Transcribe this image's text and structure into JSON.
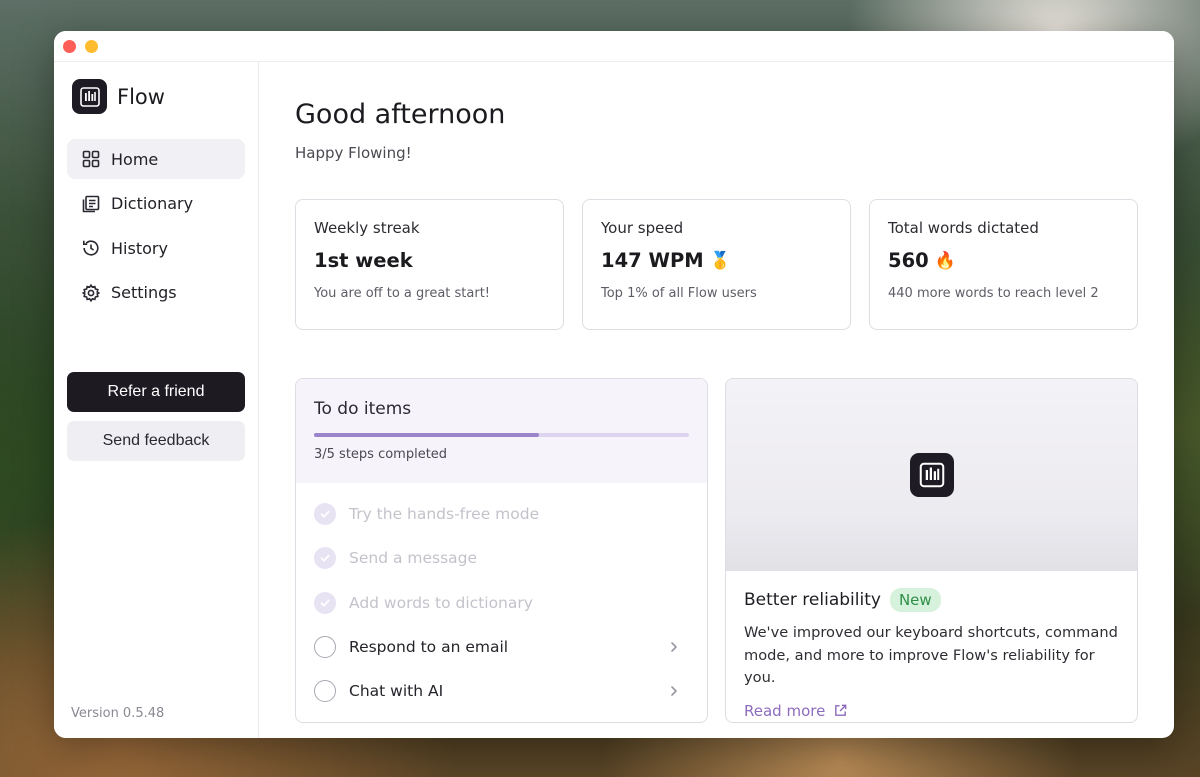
{
  "app": {
    "name": "Flow",
    "version": "Version 0.5.48"
  },
  "sidebar": {
    "items": [
      {
        "label": "Home",
        "icon": "grid-icon",
        "active": true
      },
      {
        "label": "Dictionary",
        "icon": "book-icon",
        "active": false
      },
      {
        "label": "History",
        "icon": "history-icon",
        "active": false
      },
      {
        "label": "Settings",
        "icon": "gear-icon",
        "active": false
      }
    ],
    "refer_label": "Refer a friend",
    "feedback_label": "Send feedback"
  },
  "main": {
    "greeting": "Good afternoon",
    "subgreeting": "Happy Flowing!",
    "stats": [
      {
        "title": "Weekly streak",
        "value": "1st week",
        "emoji": "",
        "sub": "You are off to a great start!"
      },
      {
        "title": "Your speed",
        "value": "147 WPM",
        "emoji": "🥇",
        "sub": "Top 1% of all Flow users"
      },
      {
        "title": "Total words dictated",
        "value": "560",
        "emoji": "🔥",
        "sub": "440 more words to reach level 2"
      }
    ]
  },
  "todo": {
    "title": "To do items",
    "progress_fraction": 0.6,
    "steps_label": "3/5 steps completed",
    "items": [
      {
        "label": "Try the hands-free mode",
        "done": true
      },
      {
        "label": "Send a message",
        "done": true
      },
      {
        "label": "Add words to dictionary",
        "done": true
      },
      {
        "label": "Respond to an email",
        "done": false
      },
      {
        "label": "Chat with AI",
        "done": false
      }
    ]
  },
  "news": {
    "title": "Better reliability",
    "badge": "New",
    "description": "We've improved our keyboard shortcuts, command mode, and more to improve Flow's reliability for you.",
    "link_label": "Read more"
  },
  "colors": {
    "accent": "#9b84c9",
    "link": "#8d6bbd",
    "badge_bg": "#d7f2dc",
    "badge_text": "#2f8f48",
    "primary_button": "#1d1a22"
  }
}
